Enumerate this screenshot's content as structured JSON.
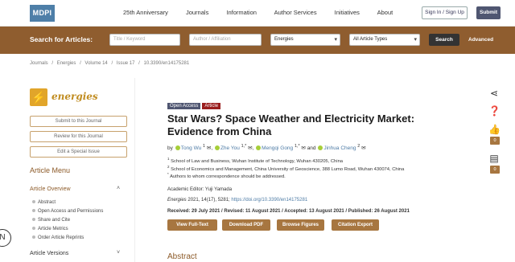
{
  "nav": {
    "logo": "MDPI",
    "links": [
      "25th Anniversary",
      "Journals",
      "Information",
      "Author Services",
      "Initiatives",
      "About"
    ],
    "signin": "Sign In / Sign Up",
    "submit": "Submit"
  },
  "search": {
    "label": "Search for Articles:",
    "title_placeholder": "Title / Keyword",
    "author_placeholder": "Author / Affiliation",
    "journal_value": "Energies",
    "type_value": "All Article Types",
    "button": "Search",
    "advanced": "Advanced"
  },
  "breadcrumb": [
    "Journals",
    "/",
    "Energies",
    "/",
    "Volume 14",
    "/",
    "Issue 17",
    "/",
    "10.3390/en14175281"
  ],
  "sidebar": {
    "journal_name": "energies",
    "buttons": [
      "Submit to this Journal",
      "Review for this Journal",
      "Edit a Special Issue"
    ],
    "menu_title": "Article Menu",
    "overview_label": "Article Overview",
    "items": [
      "Abstract",
      "Open Access and Permissions",
      "Share and Cite",
      "Article Metrics",
      "Order Article Reprints"
    ],
    "versions_label": "Article Versions"
  },
  "article": {
    "badge_oa": "Open Access",
    "badge_type": "Article",
    "title": "Star Wars? Space Weather and Electricity Market: Evidence from China",
    "by": "by",
    "authors": [
      {
        "name": "Tong Wu",
        "sup": "1"
      },
      {
        "name": "Zhe You",
        "sup": "1,*"
      },
      {
        "name": "Mengqi Gong",
        "sup": "1,*"
      },
      {
        "name": "Jinhua Cheng",
        "sup": "2"
      }
    ],
    "and": "and",
    "affiliations": [
      {
        "sup": "1",
        "text": "School of Law and Business, Wuhan Institute of Technology, Wuhan 430205, China"
      },
      {
        "sup": "2",
        "text": "School of Economics and Management, China University of Geoscience, 388 Lumo Road, Wuhan 430074, China"
      },
      {
        "sup": "*",
        "text": "Authors to whom correspondence should be addressed."
      }
    ],
    "editor": "Academic Editor: Yuji Yamada",
    "cite_journal": "Energies",
    "cite_rest": " 2021, 14(17), 5281; ",
    "doi": "https://doi.org/10.3390/en14175281",
    "dates": "Received: 29 July 2021 / Revised: 11 August 2021 / Accepted: 13 August 2021 / Published: 26 August 2021",
    "actions": [
      "View Full-Text",
      "Download PDF",
      "Browse Figures",
      "Citation Export"
    ],
    "abstract_heading": "Abstract"
  },
  "right_rail": {
    "like_count": "0",
    "comment_count": "0"
  }
}
